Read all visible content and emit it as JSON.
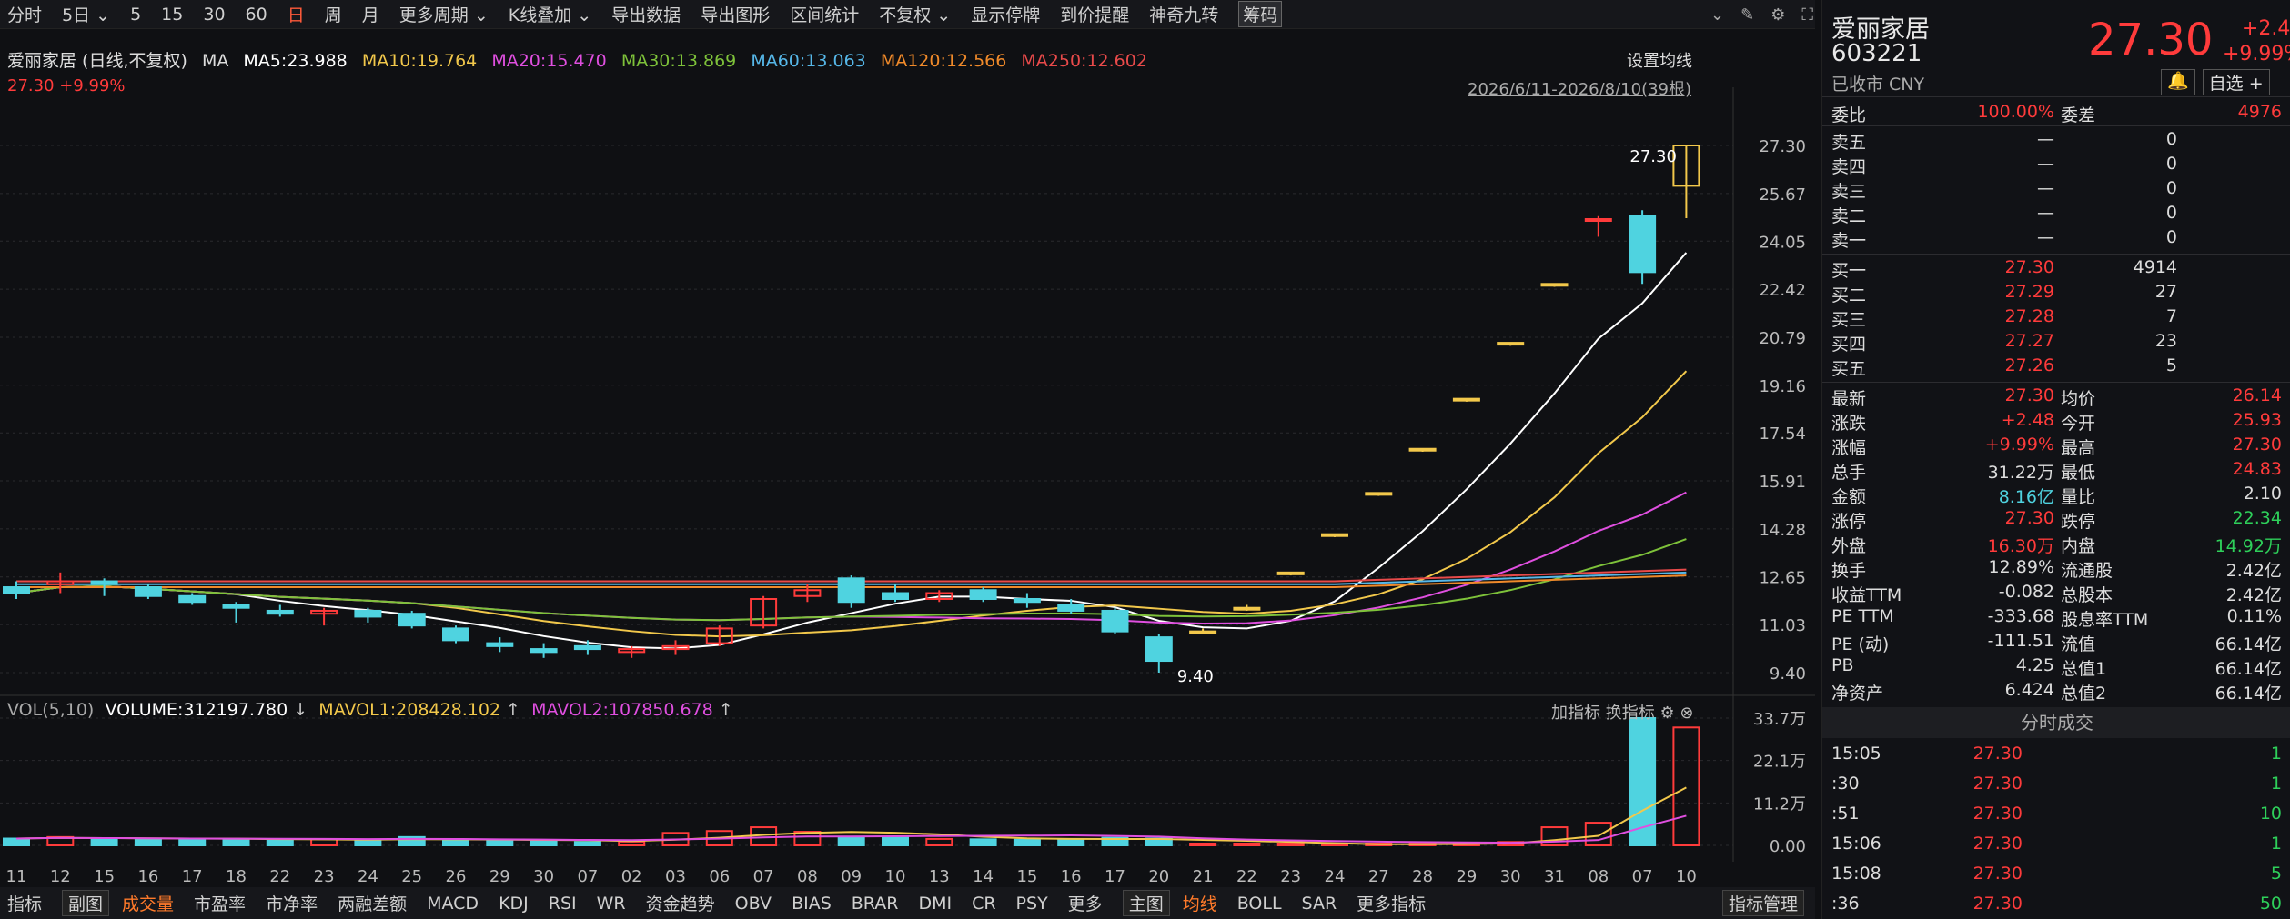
{
  "toolbar": {
    "items": [
      "分时",
      "5日",
      "5",
      "15",
      "30",
      "60",
      "日",
      "周",
      "月",
      "更多周期",
      "K线叠加",
      "导出数据",
      "导出图形",
      "区间统计",
      "不复权",
      "显示停牌",
      "到价提醒",
      "神奇九转",
      "筹码"
    ]
  },
  "chart_header": {
    "name": "爱丽家居 (日线,不复权)",
    "ma_label": "MA",
    "ma5": "MA5:23.988",
    "ma10": "MA10:19.764",
    "ma20": "MA20:15.470",
    "ma30": "MA30:13.869",
    "ma60": "MA60:13.063",
    "ma120": "MA120:12.566",
    "ma250": "MA250:12.602",
    "price_line": "27.30 +9.99%",
    "range": "2026/6/11-2026/8/10(39根)",
    "set_ma": "设置均线"
  },
  "colors": {
    "up": "#ff3b3b",
    "down": "#4fd3e0",
    "ma5": "#ffffff",
    "ma10": "#f2c84b",
    "ma20": "#e04fe0",
    "ma30": "#7ec23a",
    "ma60": "#56b7e8",
    "ma120": "#f08a2a",
    "ma250": "#e84a4a",
    "limitup": "#f2c84b"
  },
  "chart_data": {
    "type": "candlestick",
    "title": "",
    "ylim": [
      9.4,
      27.3
    ],
    "y_ticks": [
      "27.30",
      "25.67",
      "24.05",
      "22.42",
      "20.79",
      "19.16",
      "17.54",
      "15.91",
      "14.28",
      "12.65",
      "11.03",
      "9.40"
    ],
    "x_labels": [
      "11",
      "12",
      "15",
      "16",
      "17",
      "18",
      "22",
      "23",
      "24",
      "25",
      "26",
      "29",
      "30",
      "07",
      "02",
      "03",
      "06",
      "07",
      "08",
      "09",
      "10",
      "13",
      "14",
      "15",
      "16",
      "17",
      "20",
      "21",
      "22",
      "23",
      "24",
      "27",
      "28",
      "29",
      "30",
      "31",
      "08",
      "07",
      "10"
    ],
    "candles": [
      [
        12.3,
        12.5,
        11.9,
        12.1
      ],
      [
        12.4,
        12.8,
        12.1,
        12.5
      ],
      [
        12.5,
        12.6,
        12.0,
        12.4
      ],
      [
        12.3,
        12.4,
        11.9,
        12.0
      ],
      [
        12.0,
        12.1,
        11.7,
        11.8
      ],
      [
        11.7,
        11.8,
        11.1,
        11.6
      ],
      [
        11.5,
        11.7,
        11.3,
        11.4
      ],
      [
        11.4,
        11.6,
        11.0,
        11.5
      ],
      [
        11.5,
        11.6,
        11.1,
        11.3
      ],
      [
        11.4,
        11.5,
        10.9,
        11.0
      ],
      [
        10.9,
        11.0,
        10.4,
        10.5
      ],
      [
        10.4,
        10.6,
        10.1,
        10.3
      ],
      [
        10.2,
        10.4,
        9.9,
        10.1
      ],
      [
        10.3,
        10.5,
        10.0,
        10.2
      ],
      [
        10.1,
        10.3,
        9.9,
        10.2
      ],
      [
        10.2,
        10.5,
        10.0,
        10.3
      ],
      [
        10.4,
        11.0,
        10.3,
        10.9
      ],
      [
        11.0,
        12.0,
        10.9,
        11.9
      ],
      [
        12.0,
        12.4,
        11.8,
        12.2
      ],
      [
        12.6,
        12.7,
        11.6,
        11.8
      ],
      [
        12.1,
        12.4,
        11.8,
        11.9
      ],
      [
        11.9,
        12.2,
        11.8,
        12.1
      ],
      [
        12.2,
        12.3,
        11.8,
        11.9
      ],
      [
        11.9,
        12.1,
        11.6,
        11.8
      ],
      [
        11.7,
        11.9,
        11.4,
        11.5
      ],
      [
        11.5,
        11.6,
        10.7,
        10.8
      ],
      [
        10.6,
        10.7,
        9.4,
        9.8
      ],
      [
        10.8,
        10.9,
        10.7,
        10.8
      ],
      [
        11.6,
        11.7,
        11.5,
        11.6
      ],
      [
        12.8,
        12.8,
        12.7,
        12.8
      ],
      [
        14.1,
        14.1,
        14.0,
        14.1
      ],
      [
        15.5,
        15.5,
        15.4,
        15.5
      ],
      [
        17.0,
        17.0,
        16.9,
        17.0
      ],
      [
        18.7,
        18.7,
        18.6,
        18.7
      ],
      [
        20.6,
        20.6,
        20.5,
        20.6
      ],
      [
        22.6,
        22.6,
        22.5,
        22.6
      ],
      [
        24.8,
        24.9,
        24.2,
        24.8
      ],
      [
        24.9,
        25.1,
        22.6,
        23.0
      ],
      [
        25.93,
        27.3,
        24.83,
        27.3
      ]
    ],
    "limit_up_days": [
      27,
      28,
      29,
      30,
      31,
      32,
      33,
      34,
      35
    ],
    "annotations": {
      "high": "27.30",
      "low": "9.40"
    },
    "volume": {
      "ylim": [
        0,
        337000
      ],
      "y_ticks": [
        "33.7万",
        "22.1万",
        "11.2万",
        "0.00"
      ],
      "values": [
        18000,
        22000,
        18000,
        17000,
        16000,
        16000,
        15000,
        16000,
        12000,
        22000,
        15000,
        12000,
        11000,
        9000,
        10000,
        33000,
        38000,
        48000,
        36000,
        23000,
        22000,
        17000,
        16000,
        15000,
        16000,
        20000,
        18000,
        3000,
        2500,
        2500,
        3000,
        3500,
        4000,
        5000,
        9000,
        48000,
        60000,
        337000,
        312198
      ],
      "mavol1": "MAVOL1:208428.102",
      "mavol2": "MAVOL2:107850.678",
      "volume_text": "VOLUME:312197.780",
      "label": "VOL(5,10)",
      "right": "加指标 换指标"
    }
  },
  "bottom_bar": [
    "指标",
    "副图",
    "成交量",
    "市盈率",
    "市净率",
    "两融差额",
    "MACD",
    "KDJ",
    "RSI",
    "WR",
    "资金趋势",
    "OBV",
    "BIAS",
    "BRAR",
    "DMI",
    "CR",
    "PSY",
    "更多",
    "主图",
    "均线",
    "BOLL",
    "SAR",
    "更多指标"
  ],
  "bottom_right": "指标管理",
  "quote": {
    "name": "爱丽家居",
    "code": "603221",
    "status": "已收市 CNY",
    "price": "27.30",
    "change": "+2.48",
    "pct": "+9.99%",
    "btn_alert": "🔔",
    "btn_watch": "自选 +",
    "weibi": "委比",
    "weibi_v": "100.00%",
    "weicha": "委差",
    "weicha_v": "4976",
    "asks": [
      [
        "卖五",
        "—",
        "0"
      ],
      [
        "卖四",
        "—",
        "0"
      ],
      [
        "卖三",
        "—",
        "0"
      ],
      [
        "卖二",
        "—",
        "0"
      ],
      [
        "卖一",
        "—",
        "0"
      ]
    ],
    "bids": [
      [
        "买一",
        "27.30",
        "4914"
      ],
      [
        "买二",
        "27.29",
        "27"
      ],
      [
        "买三",
        "27.28",
        "7"
      ],
      [
        "买四",
        "27.27",
        "23"
      ],
      [
        "买五",
        "27.26",
        "5"
      ]
    ],
    "stats": [
      [
        "最新",
        "27.30",
        "均价",
        "26.14"
      ],
      [
        "涨跌",
        "+2.48",
        "今开",
        "25.93"
      ],
      [
        "涨幅",
        "+9.99%",
        "最高",
        "27.30"
      ],
      [
        "总手",
        "31.22万",
        "最低",
        "24.83"
      ],
      [
        "金额",
        "8.16亿",
        "量比",
        "2.10"
      ],
      [
        "涨停",
        "27.30",
        "跌停",
        "22.34"
      ],
      [
        "外盘",
        "16.30万",
        "内盘",
        "14.92万"
      ],
      [
        "换手",
        "12.89%",
        "流通股",
        "2.42亿"
      ],
      [
        "收益TTM",
        "-0.082",
        "总股本",
        "2.42亿"
      ],
      [
        "PE TTM",
        "-333.68",
        "股息率TTM",
        "0.11%"
      ],
      [
        "PE (动)",
        "-111.51",
        "流值",
        "66.14亿"
      ],
      [
        "PB",
        "4.25",
        "总值1",
        "66.14亿"
      ],
      [
        "净资产",
        "6.424",
        "总值2",
        "66.14亿"
      ]
    ],
    "trades_title": "分时成交",
    "trades": [
      [
        "15:05",
        "27.30",
        "1"
      ],
      [
        ":30",
        "27.30",
        "1"
      ],
      [
        ":51",
        "27.30",
        "10"
      ],
      [
        "15:06",
        "27.30",
        "1"
      ],
      [
        "15:08",
        "27.30",
        "5"
      ],
      [
        ":36",
        "27.30",
        "50"
      ]
    ]
  }
}
